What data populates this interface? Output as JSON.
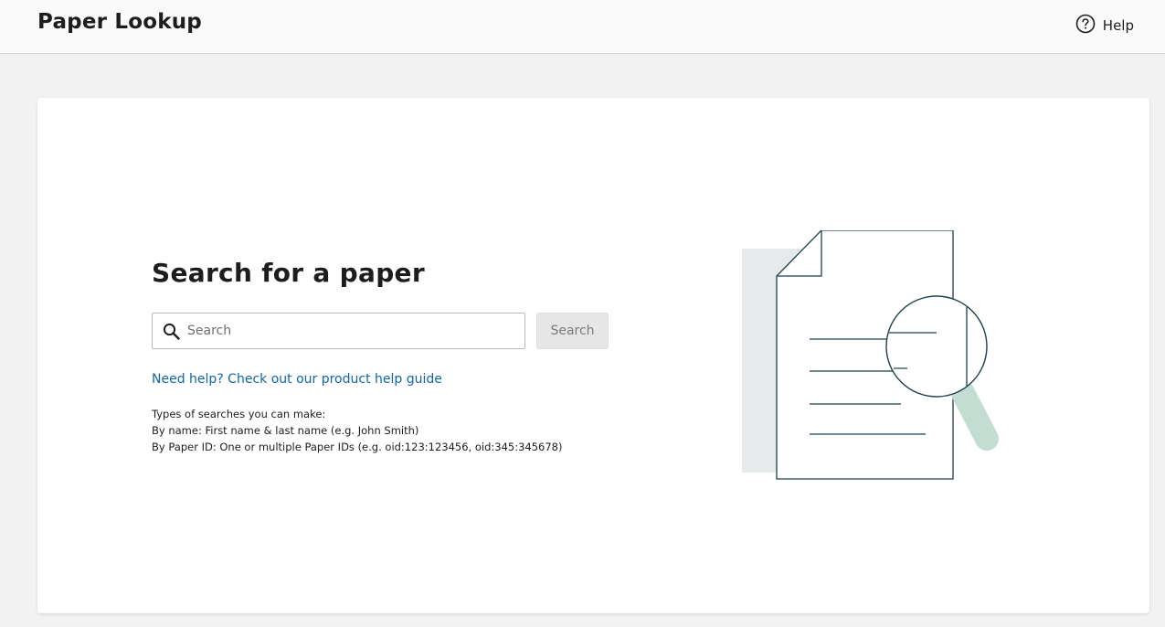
{
  "header": {
    "app_title": "Paper Lookup",
    "help_label": "Help",
    "help_icon": "question-circle-icon"
  },
  "main": {
    "heading": "Search for a paper",
    "search": {
      "placeholder": "Search",
      "value": "",
      "icon": "search-icon",
      "button_label": "Search"
    },
    "help_link": "Need help? Check out our product help guide",
    "search_types": {
      "intro": "Types of searches you can make:",
      "items": [
        "By name: First name & last name (e.g. John Smith)",
        "By Paper ID: One or multiple Paper IDs (e.g. oid:123:123456, oid:345:345678)"
      ]
    },
    "illustration": {
      "icon": "document-search-icon",
      "colors": {
        "stroke": "#1e3f4c",
        "shadow": "#e6eaea",
        "handle": "#c3ddd3"
      }
    }
  },
  "colors": {
    "link": "#1066a8",
    "page_background": "#f2f2f2",
    "card_background": "#ffffff",
    "disabled_button": "#e6e6e6"
  }
}
